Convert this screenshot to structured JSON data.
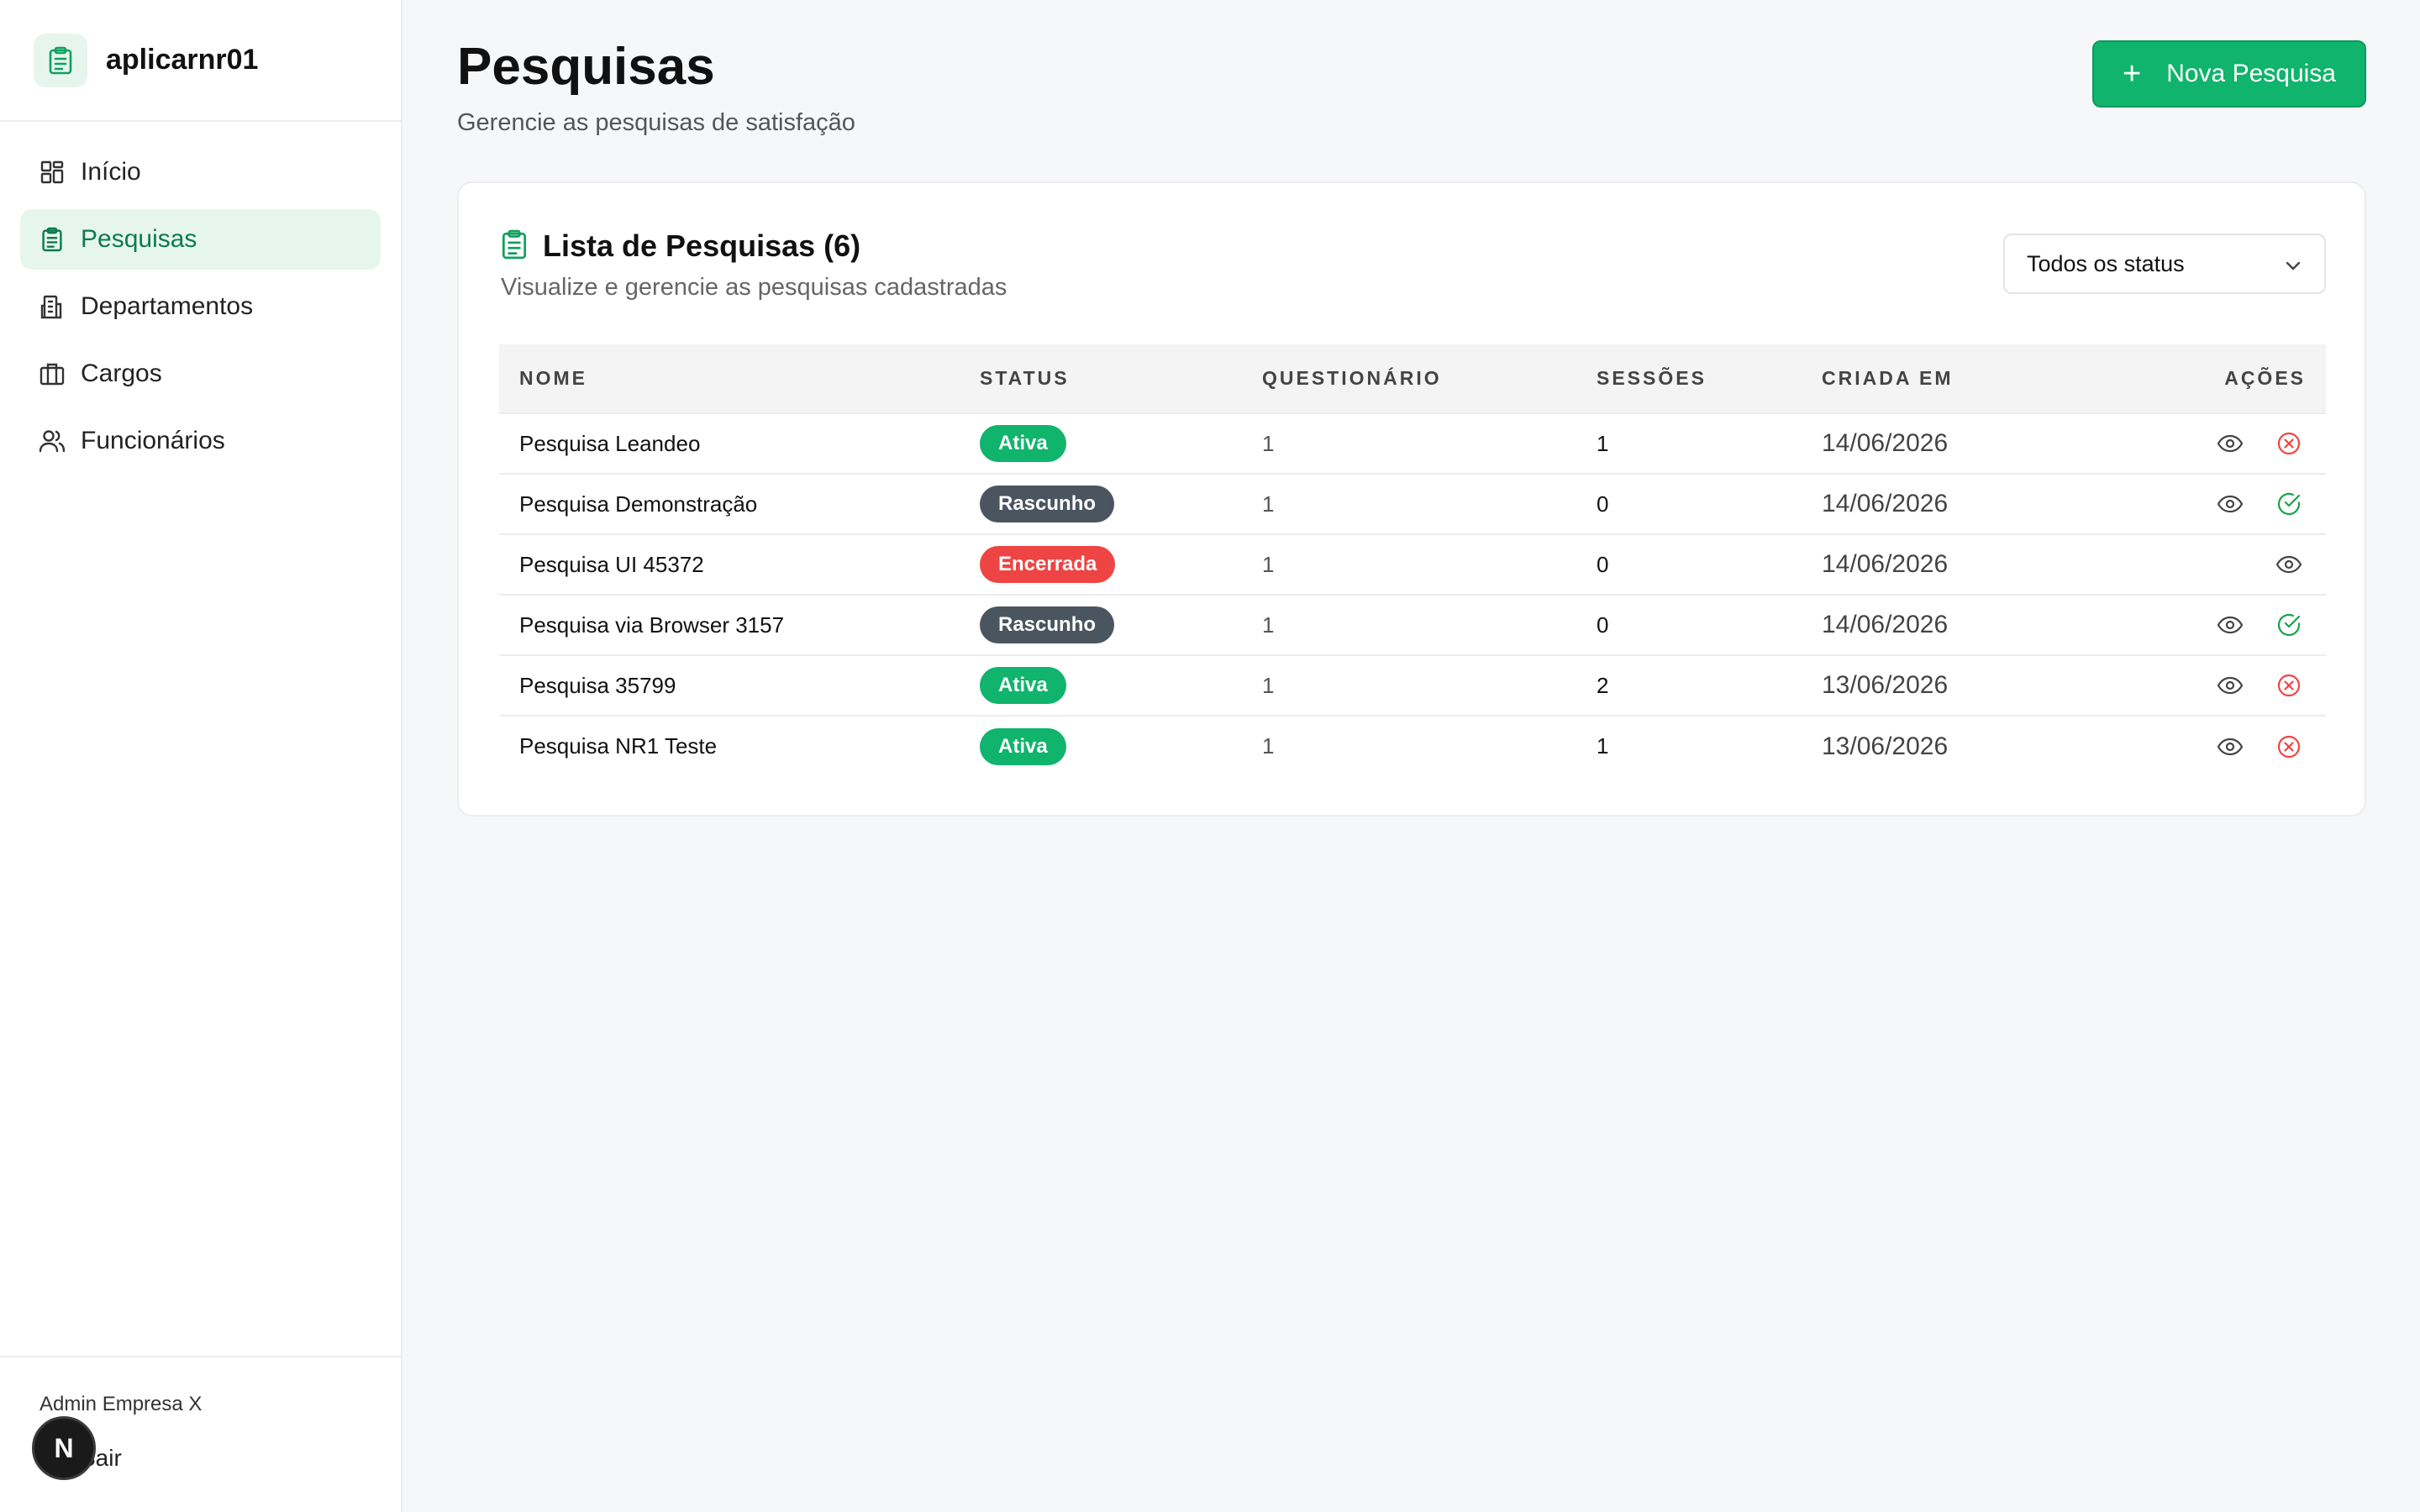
{
  "app": {
    "name": "aplicarnr01"
  },
  "sidebar": {
    "items": [
      {
        "label": "Início",
        "icon": "dashboard-icon",
        "active": false
      },
      {
        "label": "Pesquisas",
        "icon": "clipboard-icon",
        "active": true
      },
      {
        "label": "Departamentos",
        "icon": "building-icon",
        "active": false
      },
      {
        "label": "Cargos",
        "icon": "briefcase-icon",
        "active": false
      },
      {
        "label": "Funcionários",
        "icon": "users-icon",
        "active": false
      }
    ],
    "user_name": "Admin Empresa X",
    "logout_label": "Sair",
    "avatar_letter": "N"
  },
  "header": {
    "title": "Pesquisas",
    "subtitle": "Gerencie as pesquisas de satisfação",
    "new_button_label": "Nova Pesquisa"
  },
  "card": {
    "title": "Lista de Pesquisas (6)",
    "subtitle": "Visualize e gerencie as pesquisas cadastradas",
    "filter_value": "Todos os status"
  },
  "table": {
    "columns": [
      "NOME",
      "STATUS",
      "QUESTIONÁRIO",
      "SESSÕES",
      "CRIADA EM",
      "AÇÕES"
    ],
    "rows": [
      {
        "nome": "Pesquisa Leandeo",
        "status": "Ativa",
        "questionario": "1",
        "sessoes": "1",
        "criada_em": "14/06/2026",
        "actions": [
          "view",
          "close"
        ]
      },
      {
        "nome": "Pesquisa Demonstração",
        "status": "Rascunho",
        "questionario": "1",
        "sessoes": "0",
        "criada_em": "14/06/2026",
        "actions": [
          "view",
          "activate"
        ]
      },
      {
        "nome": "Pesquisa UI 45372",
        "status": "Encerrada",
        "questionario": "1",
        "sessoes": "0",
        "criada_em": "14/06/2026",
        "actions": [
          "view"
        ]
      },
      {
        "nome": "Pesquisa via Browser 3157",
        "status": "Rascunho",
        "questionario": "1",
        "sessoes": "0",
        "criada_em": "14/06/2026",
        "actions": [
          "view",
          "activate"
        ]
      },
      {
        "nome": "Pesquisa 35799",
        "status": "Ativa",
        "questionario": "1",
        "sessoes": "2",
        "criada_em": "13/06/2026",
        "actions": [
          "view",
          "close"
        ]
      },
      {
        "nome": "Pesquisa NR1 Teste",
        "status": "Ativa",
        "questionario": "1",
        "sessoes": "1",
        "criada_em": "13/06/2026",
        "actions": [
          "view",
          "close"
        ]
      }
    ]
  },
  "colors": {
    "accent": "#10b46c",
    "status_ativa": "#10b46c",
    "status_rascunho": "#4a5560",
    "status_encerrada": "#ef4444",
    "close_action": "#ef4444",
    "activate_action": "#16a34a"
  }
}
